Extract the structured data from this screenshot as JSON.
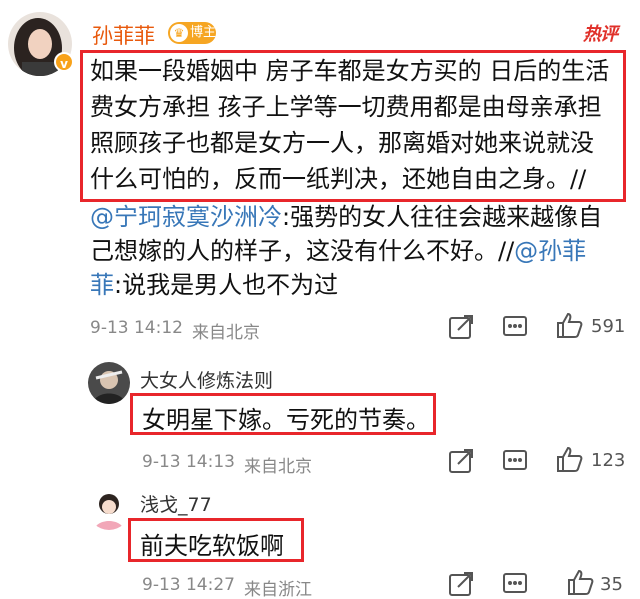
{
  "post": {
    "username": "孙菲菲",
    "badge": "博主",
    "hot_label": "热评",
    "lines": [
      "如果一段婚姻中 房子车都是女方买的 日后的生活",
      "费女方承担  孩子上学等一切费用都是由母亲承担",
      "照顾孩子也都是女方一人，那离婚对她来说就没",
      "什么可怕的，反而一纸判决，还她自由之身。//"
    ],
    "repost": {
      "mention1": "@宁珂寂寞沙洲冷",
      "line1_rest": ":强势的女人往往会越来越像自",
      "line2_text": "己想嫁的人的样子，这没有什么不好。//",
      "mention2": "@孙菲",
      "line3_mention_tail": "菲",
      "line3_rest": ":说我是男人也不为过"
    },
    "time": "9-13 14:12",
    "location": "来自北京",
    "likes": "591"
  },
  "replies": [
    {
      "username": "大女人修炼法则",
      "text": "女明星下嫁。亏死的节奏。",
      "time": "9-13 14:13",
      "location": "来自北京",
      "likes": "123"
    },
    {
      "username": "浅戈_77",
      "text": "前夫吃软饭啊",
      "time": "9-13 14:27",
      "location": "来自浙江",
      "likes": "35"
    }
  ],
  "icons": [
    "share-icon",
    "comment-icon",
    "like-icon",
    "verified-icon"
  ],
  "colors": {
    "username": "#e8590c",
    "mention": "#3877b8",
    "highlight_box": "#e8262b",
    "meta": "#888888"
  }
}
